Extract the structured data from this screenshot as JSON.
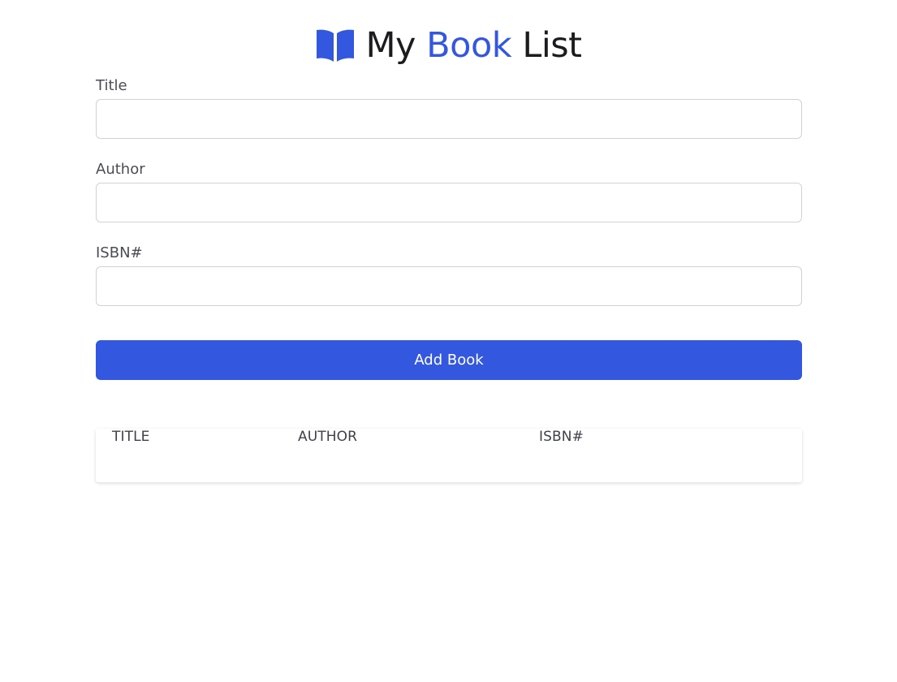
{
  "header": {
    "title_prefix": "My",
    "title_accent": "Book",
    "title_suffix": "List",
    "icon": "book-open-icon",
    "accent_color": "#3457e0"
  },
  "form": {
    "title": {
      "label": "Title",
      "value": "",
      "placeholder": ""
    },
    "author": {
      "label": "Author",
      "value": "",
      "placeholder": ""
    },
    "isbn": {
      "label": "ISBN#",
      "value": "",
      "placeholder": ""
    },
    "submit_label": "Add Book",
    "submit_color": "#3457e0"
  },
  "table": {
    "columns": [
      "TITLE",
      "AUTHOR",
      "ISBN#"
    ],
    "rows": []
  }
}
